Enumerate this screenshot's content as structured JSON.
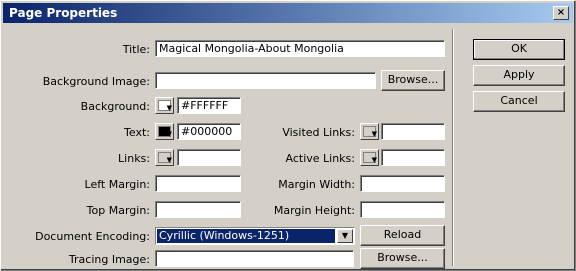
{
  "window": {
    "title": "Page Properties",
    "close_label": "×"
  },
  "fields": {
    "title_label": "Title:",
    "title_value": "Magical Mongolia-About Mongolia",
    "bg_image_label": "Background Image:",
    "bg_image_value": "",
    "background_label": "Background:",
    "background_value": "#FFFFFF",
    "text_label": "Text:",
    "text_value": "#000000",
    "links_label": "Links:",
    "links_value": "",
    "visited_links_label": "Visited Links:",
    "visited_links_value": "",
    "active_links_label": "Active Links:",
    "active_links_value": "",
    "left_margin_label": "Left Margin:",
    "left_margin_value": "",
    "margin_width_label": "Margin Width:",
    "margin_width_value": "",
    "top_margin_label": "Top Margin:",
    "top_margin_value": "",
    "margin_height_label": "Margin Height:",
    "margin_height_value": "",
    "doc_encoding_label": "Document Encoding:",
    "doc_encoding_value": "Cyrillic (Windows-1251)",
    "tracing_label": "Tracing Image:",
    "tracing_value": ""
  },
  "buttons": {
    "browse1": "Browse...",
    "reload": "Reload",
    "browse2": "Browse...",
    "ok": "OK",
    "apply": "Apply",
    "cancel": "Cancel"
  },
  "colors": {
    "titlebar": "#0a246a",
    "dialog_bg": "#d4d0c8",
    "selection": "#0a246a"
  }
}
